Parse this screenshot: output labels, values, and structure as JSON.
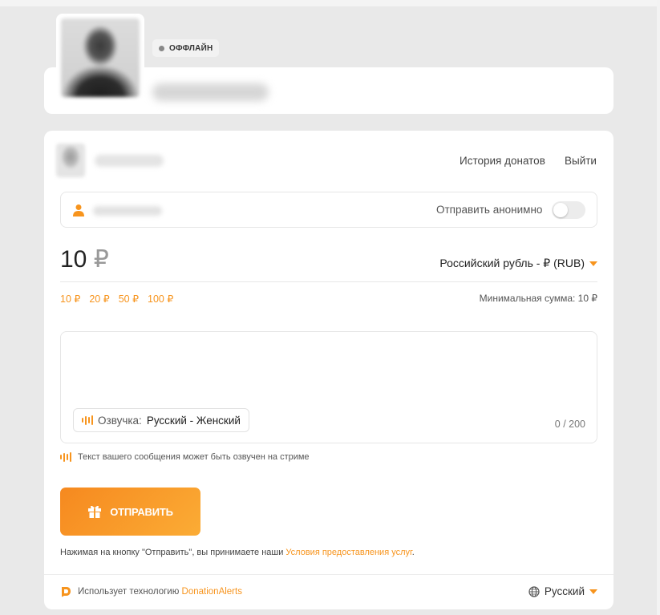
{
  "profile": {
    "status_label": "ОФФЛАЙН"
  },
  "user_bar": {
    "history_link": "История донатов",
    "logout_link": "Выйти"
  },
  "name_field": {
    "anonymous_label": "Отправить анонимно",
    "anonymous_enabled": false
  },
  "amount": {
    "value": "10",
    "currency_symbol": "₽",
    "currency_select": "Российский рубль - ₽ (RUB)",
    "presets": [
      "10 ₽",
      "20 ₽",
      "50 ₽",
      "100 ₽"
    ],
    "minimum": "Минимальная сумма: 10 ₽"
  },
  "message": {
    "voice_label": "Озвучка:",
    "voice_value": "Русский - Женский",
    "counter": "0 / 200",
    "hint": "Текст вашего сообщения может быть озвучен на стриме"
  },
  "send": {
    "label": "ОТПРАВИТЬ",
    "terms_prefix": "Нажимая на кнопку \"Отправить\", вы принимаете наши ",
    "terms_link": "Условия предоставления услуг",
    "terms_suffix": "."
  },
  "footer": {
    "powered_prefix": "Использует технологию ",
    "powered_link": "DonationAlerts",
    "language": "Русский"
  },
  "colors": {
    "accent": "#f7941d",
    "background": "#e9e9e9",
    "card": "#ffffff"
  },
  "icons": [
    "person-icon",
    "sound-wave-icon",
    "gift-icon",
    "donationalerts-logo-icon",
    "globe-icon",
    "chevron-down-icon"
  ]
}
